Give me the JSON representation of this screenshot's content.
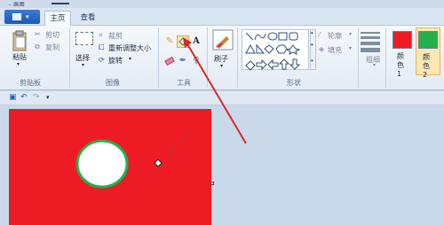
{
  "window": {
    "title_fragment": "- 画图"
  },
  "tabs": [
    {
      "label": "主页",
      "active": true
    },
    {
      "label": "查看",
      "active": false
    }
  ],
  "clipboard": {
    "paste_label": "粘贴",
    "cut_label": "剪切",
    "copy_label": "复制",
    "group_label": "剪贴板"
  },
  "image": {
    "select_label": "选择",
    "crop_label": "裁剪",
    "resize_label": "重新调整大小",
    "rotate_label": "旋转",
    "group_label": "图像"
  },
  "tools": {
    "group_label": "工具",
    "text_tool_glyph": "A"
  },
  "brushes": {
    "label": "刷子"
  },
  "shapes": {
    "outline_label": "轮廓",
    "fill_label": "填充",
    "group_label": "形状"
  },
  "size": {
    "label": "粗细"
  },
  "colors": {
    "color1_label": "颜色 1",
    "color2_label": "颜色 2",
    "color1": "#ed1c24",
    "color2": "#22b14c"
  },
  "quick_access": {
    "more_glyph": "▾"
  },
  "canvas": {
    "background": "#ed1c24",
    "circle_fill": "#ffffff",
    "circle_outline": "#22b14c"
  },
  "annotation": {
    "arrow_color": "#d42a2a"
  }
}
